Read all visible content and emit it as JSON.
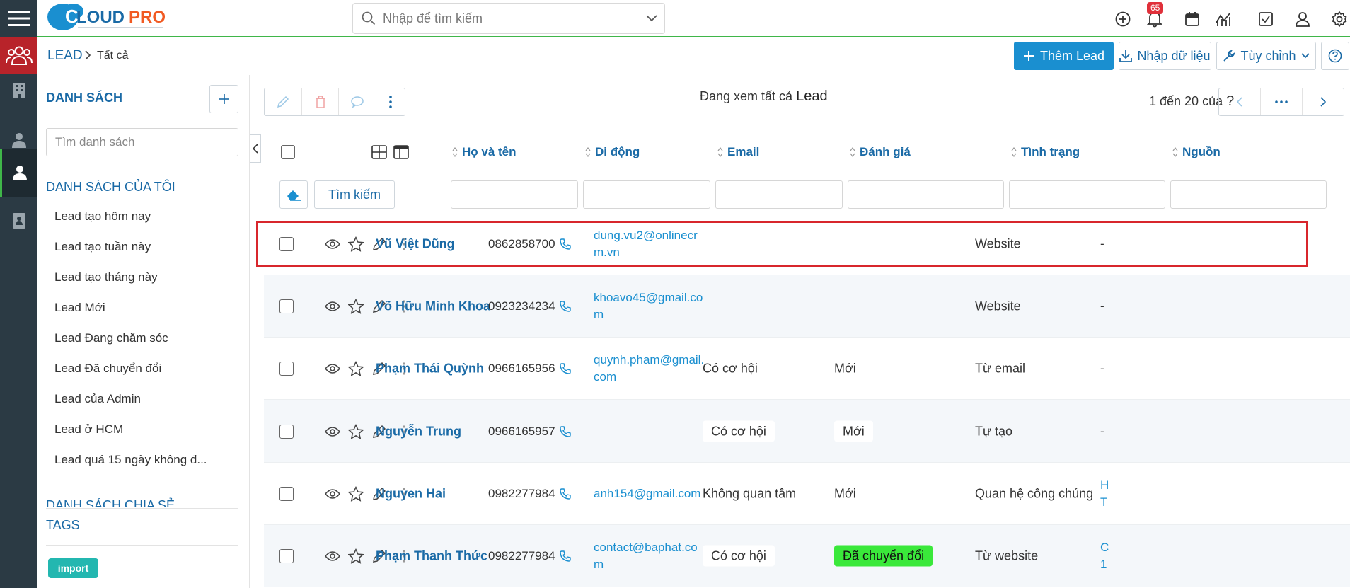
{
  "header": {
    "logo_text": "CLOUDPRO",
    "search_placeholder": "Nhập để tìm kiếm",
    "notification_count": "65",
    "icons": [
      "plus-circle-icon",
      "bell-icon",
      "calendar-icon",
      "chart-icon",
      "checkbox-icon",
      "user-icon",
      "gear-icon"
    ]
  },
  "rail": {
    "items": [
      "team-icon",
      "building-icon",
      "contact-icon",
      "lead-person-icon",
      "document-icon"
    ],
    "active_color": "#b8232a"
  },
  "breadcrumb": {
    "module": "LEAD",
    "current": "Tất cả"
  },
  "actions": {
    "add_lead": "Thêm Lead",
    "import": "Nhập dữ liệu",
    "customize": "Tùy chỉnh",
    "help_icon": "question-circle-icon"
  },
  "sidebar": {
    "lists_title": "DANH SÁCH",
    "search_placeholder": "Tìm danh sách",
    "my_lists_title": "DANH SÁCH CỦA TÔI",
    "my_lists": [
      "Lead tạo hôm nay",
      "Lead tạo tuần này",
      "Lead tạo tháng này",
      "Lead Mới",
      "Lead Đang chăm sóc",
      "Lead Đã chuyển đổi",
      "Lead của Admin",
      "Lead ở HCM",
      "Lead quá 15 ngày không đ..."
    ],
    "shared_title": "DANH SÁCH CHIA SẺ",
    "tags_title": "TAGS",
    "tags": [
      "import"
    ]
  },
  "listview": {
    "viewing_prefix": "Đang xem tất cả",
    "viewing_module": "Lead",
    "pagination": "1 đến 20 của",
    "pagination_unknown": "?",
    "search_button": "Tìm kiếm",
    "columns": [
      "Họ và tên",
      "Di động",
      "Email",
      "Đánh giá",
      "Tình trạng",
      "Nguồn"
    ],
    "rows": [
      {
        "name": "Vũ Việt Dũng",
        "phone": "0862858700",
        "email": "dung.vu2@onlinecr m.vn",
        "rating": "",
        "status": "",
        "source": "Website",
        "extra": "-"
      },
      {
        "name": "Võ Hữu Minh Khoa",
        "phone": "0923234234",
        "email": "khoavo45@gmail.co m",
        "rating": "",
        "status": "",
        "source": "Website",
        "extra": "-"
      },
      {
        "name": "Phạm Thái Quỳnh",
        "phone": "0966165956",
        "email": "quynh.pham@gmail. com",
        "rating": "Có cơ hội",
        "status": "Mới",
        "source": "Từ email",
        "extra": "-"
      },
      {
        "name": "Nguyễn Trung",
        "phone": "0966165957",
        "email": "",
        "rating": "Có cơ hội",
        "status": "Mới",
        "source": "Tự tạo",
        "extra": "-"
      },
      {
        "name": "Nguyen Hai",
        "phone": "0982277984",
        "email": "anh154@gmail.com",
        "rating": "Không quan tâm",
        "status": "Mới",
        "source": "Quan hệ công chúng",
        "extra": "H T"
      },
      {
        "name": "Phạm Thanh Thức",
        "phone": "0982277984",
        "email": "contact@baphat.co m",
        "rating": "Có cơ hội",
        "status": "Đã chuyển đổi",
        "source": "Từ website",
        "extra": "C 1"
      }
    ],
    "highlight_color": "#d8262c",
    "converted_color": "#3ae83a"
  }
}
